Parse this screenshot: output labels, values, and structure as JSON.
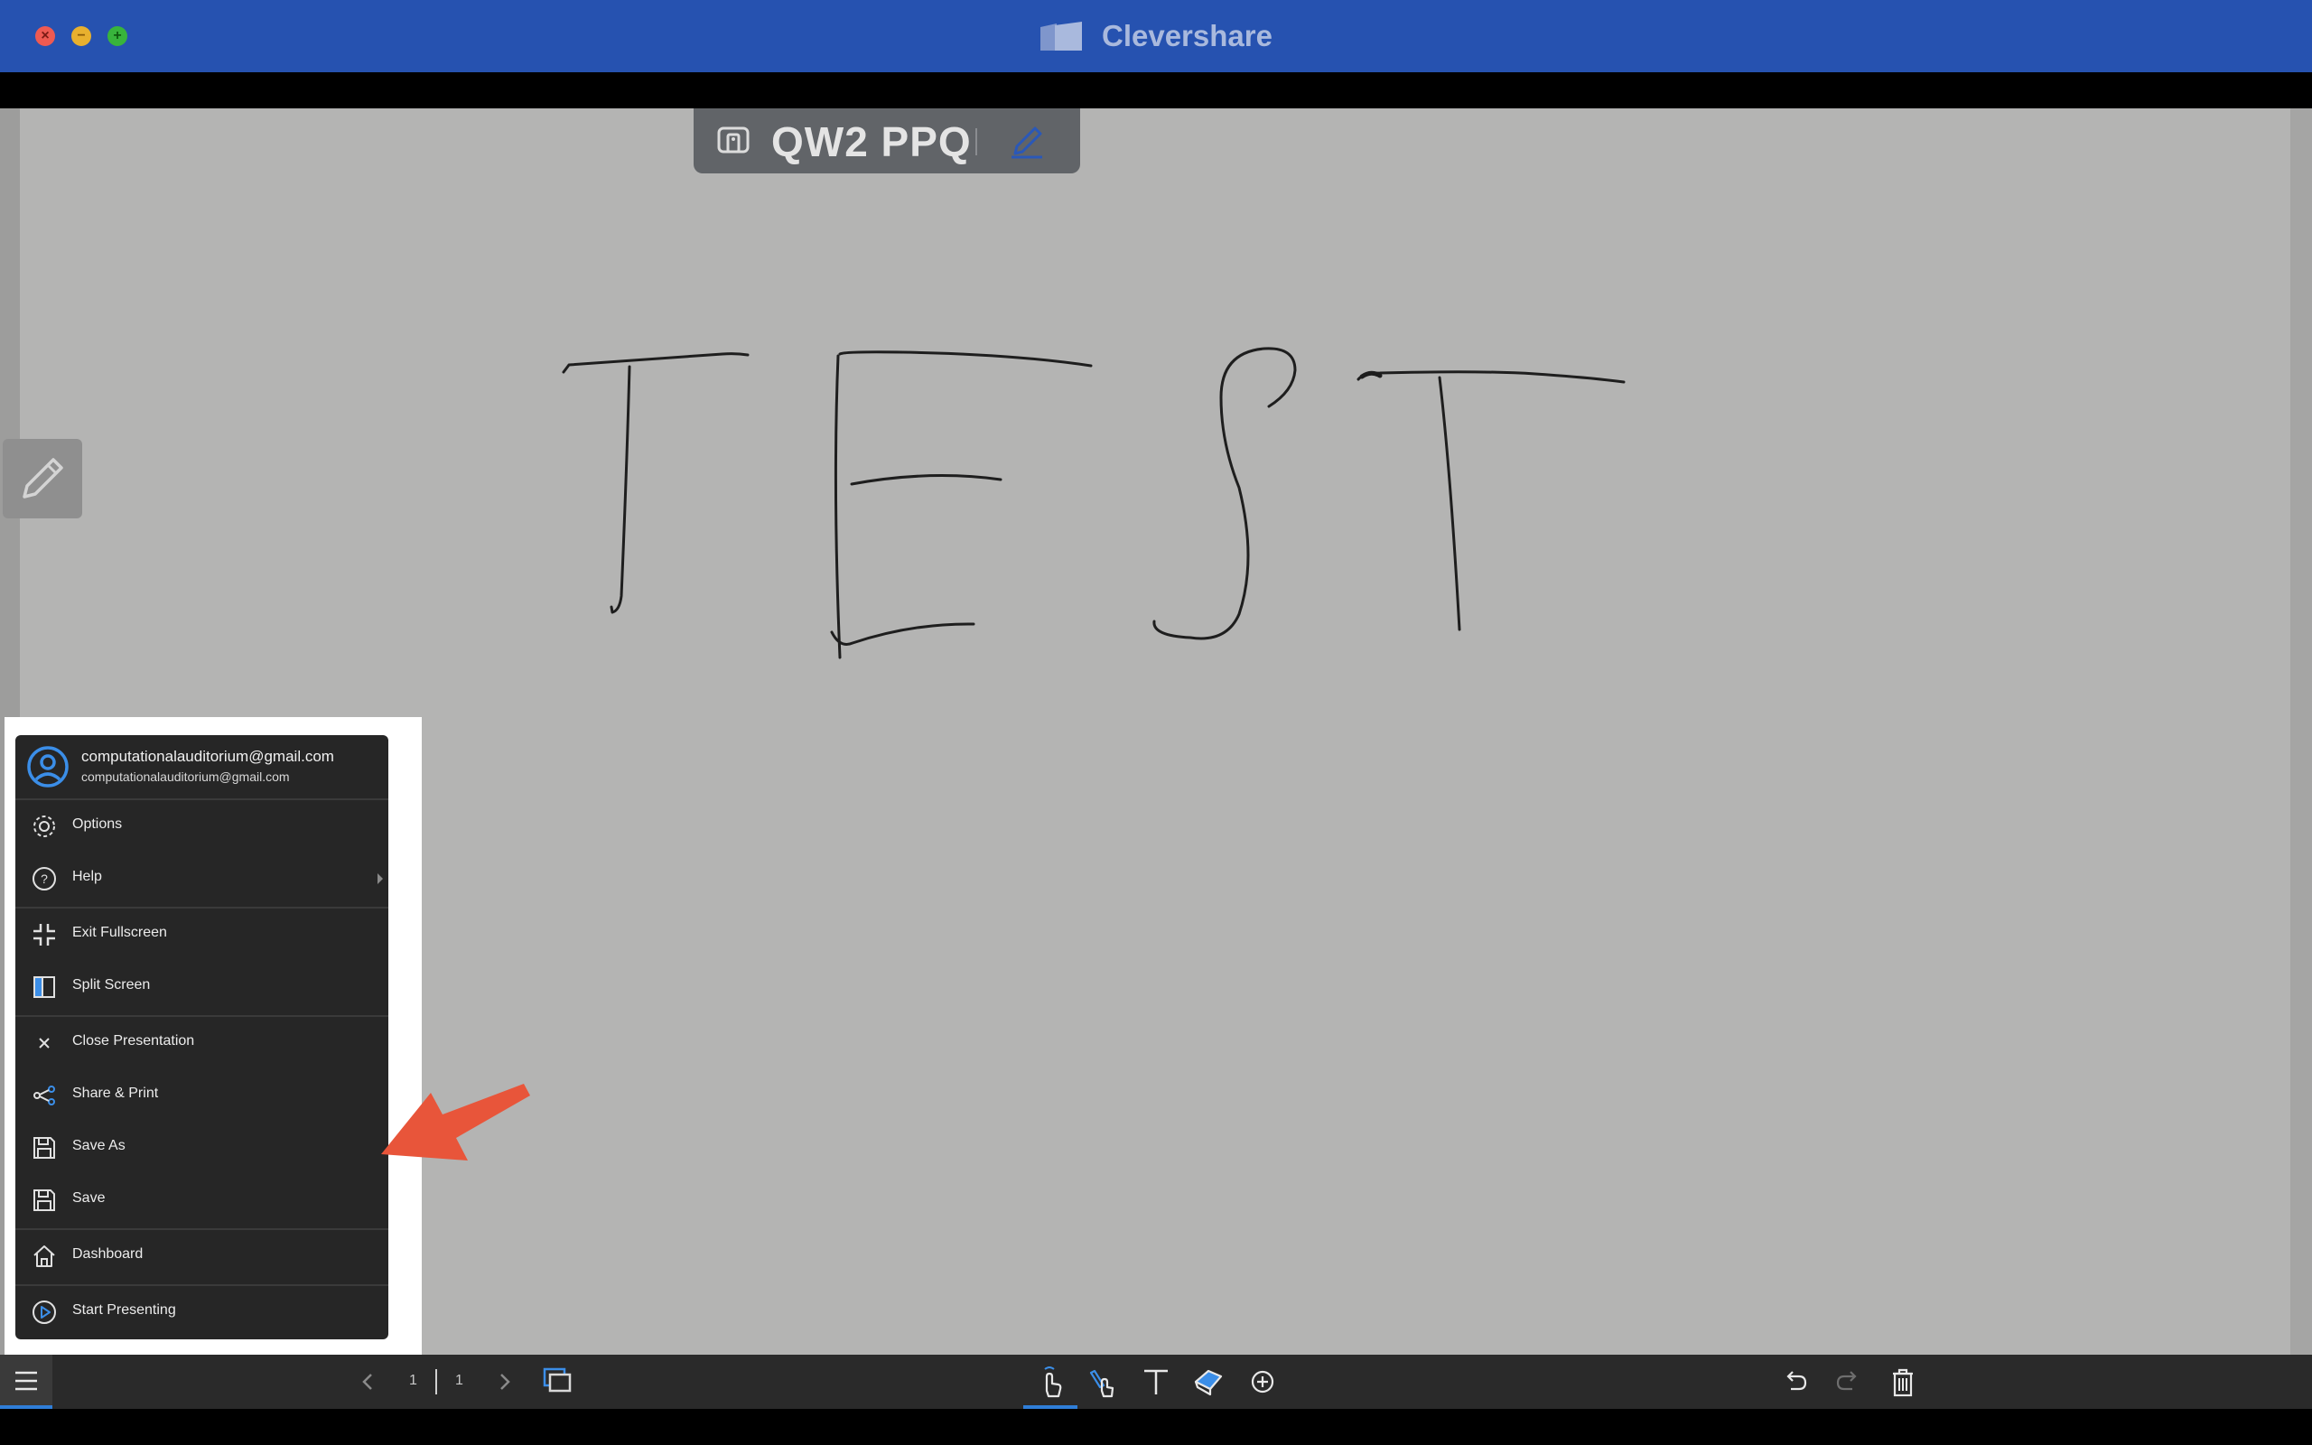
{
  "app": {
    "title": "Clevershare"
  },
  "room": {
    "code": "QW2 PPQ"
  },
  "menu": {
    "user": {
      "name": "computationalauditorium@gmail.com",
      "email": "computationalauditorium@gmail.com"
    },
    "items": [
      {
        "label": "Options",
        "icon": "gear-icon"
      },
      {
        "label": "Help",
        "icon": "help-icon",
        "has_submenu": true
      },
      {
        "label": "Exit Fullscreen",
        "icon": "exit-fullscreen-icon"
      },
      {
        "label": "Split Screen",
        "icon": "split-screen-icon"
      },
      {
        "label": "Close Presentation",
        "icon": "close-icon"
      },
      {
        "label": "Share & Print",
        "icon": "share-icon"
      },
      {
        "label": "Save As",
        "icon": "save-as-icon"
      },
      {
        "label": "Save",
        "icon": "save-icon"
      },
      {
        "label": "Dashboard",
        "icon": "home-icon"
      },
      {
        "label": "Start Presenting",
        "icon": "play-icon"
      }
    ]
  },
  "pagination": {
    "current": "1",
    "total": "1"
  },
  "toolbar": {
    "tools": [
      "touch-tool-icon",
      "pen-tool-icon",
      "text-tool-icon",
      "eraser-tool-icon",
      "add-icon"
    ],
    "actions": [
      "undo-icon",
      "redo-icon",
      "trash-icon"
    ]
  },
  "colors": {
    "titlebar": "#2652b0",
    "canvas": "#b4b4b3",
    "menu_bg": "#262626",
    "accent": "#2f7ed8",
    "annotation_arrow": "#e8553a"
  }
}
